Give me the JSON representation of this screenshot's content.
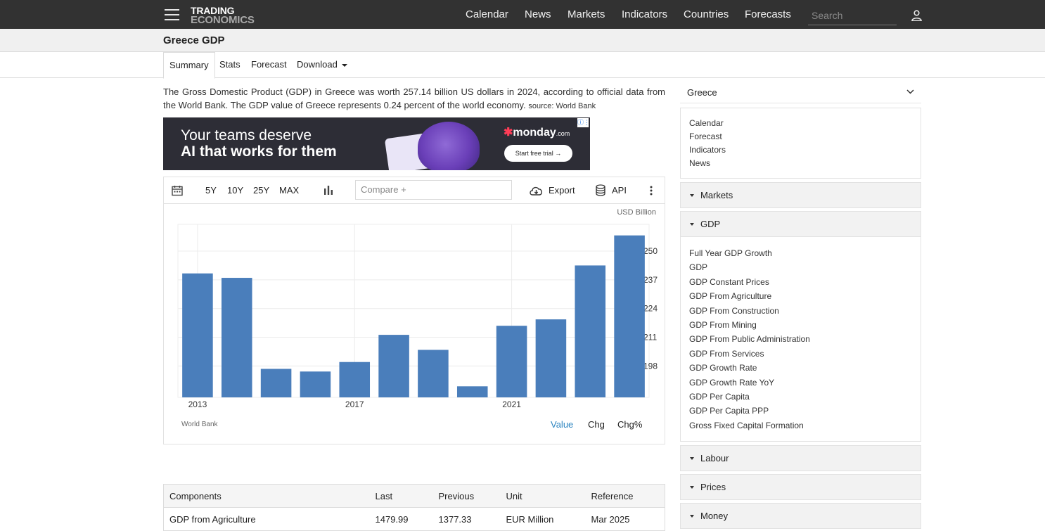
{
  "header": {
    "logo_line1": "TRADING",
    "logo_line2": "ECONOMICS",
    "nav": [
      "Calendar",
      "News",
      "Markets",
      "Indicators",
      "Countries",
      "Forecasts"
    ],
    "search_placeholder": "Search"
  },
  "page": {
    "title": "Greece GDP"
  },
  "tabs": [
    "Summary",
    "Stats",
    "Forecast",
    "Download"
  ],
  "description": {
    "text": "The Gross Domestic Product (GDP) in Greece was worth 257.14 billion US dollars in 2024, according to official data from the World Bank. The GDP value of Greece represents 0.24 percent of the world economy.",
    "source": "source: World Bank"
  },
  "ad": {
    "line1": "Your teams deserve",
    "line2": "AI that works for them",
    "brand": "monday",
    "brand_suffix": ".com",
    "cta": "Start free trial  →"
  },
  "toolbar": {
    "ranges": [
      "5Y",
      "10Y",
      "25Y",
      "MAX"
    ],
    "compare_placeholder": "Compare +",
    "export_label": "Export",
    "api_label": "API"
  },
  "chart_data": {
    "type": "bar",
    "unit": "USD Billion",
    "x": [
      2013,
      2014,
      2015,
      2016,
      2017,
      2018,
      2019,
      2020,
      2021,
      2022,
      2023,
      2024
    ],
    "values": [
      239.9,
      237.9,
      196.7,
      195.5,
      199.8,
      212.1,
      205.3,
      188.8,
      216.2,
      219.1,
      243.5,
      257.1
    ],
    "x_tick_labels": [
      "2013",
      "2017",
      "2021"
    ],
    "y_tick_labels": [
      "250",
      "237",
      "224",
      "211",
      "198"
    ],
    "ylim": [
      183.8,
      262.1
    ],
    "bar_color": "#4a7ebb",
    "source": "World Bank",
    "modes": [
      "Value",
      "Chg",
      "Chg%"
    ],
    "active_mode": "Value"
  },
  "components_table": {
    "headers": [
      "Components",
      "Last",
      "Previous",
      "Unit",
      "Reference"
    ],
    "rows": [
      [
        "GDP from Agriculture",
        "1479.99",
        "1377.33",
        "EUR Million",
        "Mar 2025"
      ]
    ]
  },
  "sidebar": {
    "country": "Greece",
    "links": [
      "Calendar",
      "Forecast",
      "Indicators",
      "News"
    ],
    "sections": [
      "Markets",
      "GDP",
      "Labour",
      "Prices",
      "Money"
    ],
    "gdp_items": [
      "Full Year GDP Growth",
      "GDP",
      "GDP Constant Prices",
      "GDP From Agriculture",
      "GDP From Construction",
      "GDP From Mining",
      "GDP From Public Administration",
      "GDP From Services",
      "GDP Growth Rate",
      "GDP Growth Rate YoY",
      "GDP Per Capita",
      "GDP Per Capita PPP",
      "Gross Fixed Capital Formation"
    ]
  },
  "colors": {
    "topbar": "#323232",
    "accent": "#2e86c1",
    "bar": "#4a7ebb"
  }
}
